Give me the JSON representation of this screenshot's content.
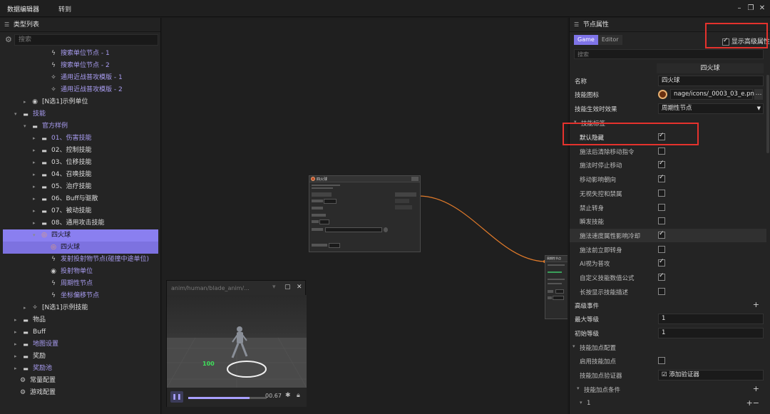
{
  "topbar": {
    "title": "数据编辑器",
    "menu": "转到",
    "win_icons": [
      "minimize-icon",
      "restore-icon",
      "close-icon"
    ]
  },
  "left": {
    "header": "类型列表",
    "search_placeholder": "搜索",
    "tree": [
      {
        "label": "搜索单位节点 - 1",
        "icon": "bolt-icon",
        "color": "purple",
        "indent": 3
      },
      {
        "label": "搜索单位节点 - 2",
        "icon": "bolt-icon",
        "color": "purple",
        "indent": 3
      },
      {
        "label": "通用近战普攻模版 - 1",
        "icon": "sparkle-icon",
        "color": "purple",
        "indent": 3
      },
      {
        "label": "通用近战普攻模版 - 2",
        "icon": "sparkle-icon",
        "color": "purple",
        "indent": 3
      },
      {
        "label": "[N选1]示例单位",
        "icon": "unit-icon",
        "color": "white",
        "indent": 1,
        "arrow": "▸"
      },
      {
        "label": "技能",
        "icon": "folder-icon",
        "color": "purple",
        "indent": 0,
        "arrow": "▾"
      },
      {
        "label": "官方样例",
        "icon": "folder-icon",
        "color": "purple",
        "indent": 1,
        "arrow": "▾"
      },
      {
        "label": "01、伤害技能",
        "icon": "folder-icon",
        "color": "purple",
        "indent": 2,
        "arrow": "▸"
      },
      {
        "label": "02、控制技能",
        "icon": "folder-icon",
        "color": "white",
        "indent": 2,
        "arrow": "▸"
      },
      {
        "label": "03、位移技能",
        "icon": "folder-icon",
        "color": "white",
        "indent": 2,
        "arrow": "▸"
      },
      {
        "label": "04、召唤技能",
        "icon": "folder-icon",
        "color": "white",
        "indent": 2,
        "arrow": "▸"
      },
      {
        "label": "05、治疗技能",
        "icon": "folder-icon",
        "color": "white",
        "indent": 2,
        "arrow": "▸"
      },
      {
        "label": "06、Buff与驱散",
        "icon": "folder-icon",
        "color": "white",
        "indent": 2,
        "arrow": "▸"
      },
      {
        "label": "07、被动技能",
        "icon": "folder-icon",
        "color": "white",
        "indent": 2,
        "arrow": "▸"
      },
      {
        "label": "08、通用攻击技能",
        "icon": "folder-icon",
        "color": "white",
        "indent": 2,
        "arrow": "▸"
      },
      {
        "label": "四火球",
        "icon": "fireball-icon",
        "color": "sel",
        "indent": 2,
        "arrow": "▾"
      },
      {
        "label": "四火球",
        "icon": "fireball-icon",
        "color": "sel2",
        "indent": 3
      },
      {
        "label": "发射投射物节点(碰撞中途单位)",
        "icon": "bolt-icon",
        "color": "purple",
        "indent": 3
      },
      {
        "label": "投射物单位",
        "icon": "unit-icon",
        "color": "purple",
        "indent": 3
      },
      {
        "label": "周期性节点",
        "icon": "bolt-icon",
        "color": "purple",
        "indent": 3
      },
      {
        "label": "坐标偏移节点",
        "icon": "bolt-icon",
        "color": "purple",
        "indent": 3
      },
      {
        "label": "[N选1]示例技能",
        "icon": "sparkle-icon",
        "color": "white",
        "indent": 1,
        "arrow": "▸"
      },
      {
        "label": "物品",
        "icon": "folder-icon",
        "color": "white",
        "indent": 0,
        "arrow": "▸"
      },
      {
        "label": "Buff",
        "icon": "folder-icon",
        "color": "white",
        "indent": 0,
        "arrow": "▸"
      },
      {
        "label": "地图设置",
        "icon": "folder-icon",
        "color": "purple",
        "indent": 0,
        "arrow": "▸"
      },
      {
        "label": "奖励",
        "icon": "folder-icon",
        "color": "white",
        "indent": 0,
        "arrow": "▸"
      },
      {
        "label": "奖励池",
        "icon": "folder-icon",
        "color": "purple",
        "indent": 0,
        "arrow": "▸"
      },
      {
        "label": "常量配置",
        "icon": "gear-icon",
        "color": "white",
        "indent": -1
      },
      {
        "label": "游戏配置",
        "icon": "gear-icon",
        "color": "white",
        "indent": -1
      }
    ]
  },
  "preview": {
    "path": "anim/human/blade_anim/...",
    "time": "00.67",
    "hit": "100",
    "progress": 0.78
  },
  "node_main": {
    "title": "四火球"
  },
  "node_target": {
    "title": "周期性节点"
  },
  "right": {
    "header": "节点属性",
    "tab_game": "Game",
    "tab_editor": "Editor",
    "show_advanced": "显示高级属性",
    "search_placeholder": "搜索",
    "value_header": "四火球",
    "name_label": "名称",
    "name_value": "四火球",
    "icon_label": "技能图标",
    "icon_value": "nage/icons/_0003_03_e.png",
    "effect_label": "技能生效时效果",
    "effect_value": "周期性节点",
    "flags_label": "技能标签",
    "flags": [
      {
        "label": "默认隐藏",
        "checked": true
      },
      {
        "label": "施法后清除移动指令",
        "checked": false
      },
      {
        "label": "施法时停止移动",
        "checked": true
      },
      {
        "label": "移动影响朝向",
        "checked": true
      },
      {
        "label": "无视失控和禁属",
        "checked": false
      },
      {
        "label": "禁止转身",
        "checked": false
      },
      {
        "label": "瞬发技能",
        "checked": false
      },
      {
        "label": "施法速度属性影响冷却",
        "checked": true
      },
      {
        "label": "施法前立即转身",
        "checked": false
      },
      {
        "label": "AI视为普攻",
        "checked": true
      },
      {
        "label": "自定义技能数值公式",
        "checked": true
      },
      {
        "label": "长按显示技能描述",
        "checked": false
      }
    ],
    "adv_event": "高级事件",
    "max_level_label": "最大等级",
    "max_level": "1",
    "init_level_label": "初始等级",
    "init_level": "1",
    "points_cfg": "技能加点配置",
    "enable_points": "启用技能加点",
    "points_validator": "技能加点验证器",
    "add_validator": "添加验证器",
    "points_cond": "技能加点条件",
    "list_index": "1"
  }
}
